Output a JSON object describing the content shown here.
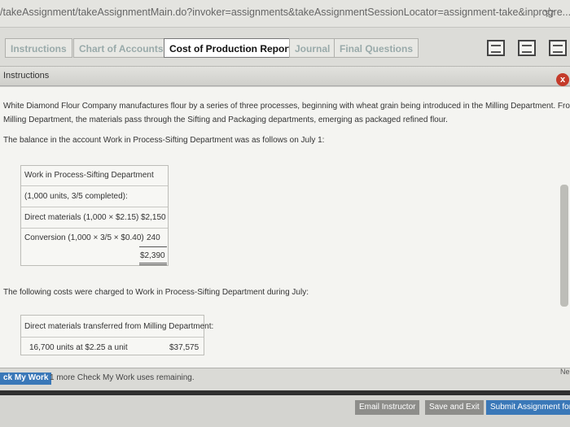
{
  "browser": {
    "url": "/takeAssignment/takeAssignmentMain.do?invoker=assignments&takeAssignmentSessionLocator=assignment-take&inprogre...",
    "star_icon": "star-icon"
  },
  "tabs": [
    {
      "label": "Instructions",
      "state": "dim"
    },
    {
      "label": "Chart of Accounts",
      "state": "dim"
    },
    {
      "label": "Cost of Production Report",
      "state": "active"
    },
    {
      "label": "Journal",
      "state": "dim"
    },
    {
      "label": "Final Questions",
      "state": "dim"
    }
  ],
  "toolbar_icons": [
    "print-icon",
    "calculator-icon",
    "notes-icon"
  ],
  "panel": {
    "title": "Instructions",
    "close_label": "x"
  },
  "content": {
    "intro_line1": "White Diamond Flour Company manufactures flour by a series of three processes, beginning with wheat grain being introduced in the Milling Department. From the",
    "intro_line2": "Milling Department, the materials pass through the Sifting and Packaging departments, emerging as packaged refined flour.",
    "balance_text": "The balance in the account Work in Process-Sifting Department was as follows on July 1:",
    "wip_table": {
      "title": "Work in Process-Sifting Department",
      "units_line": "(1,000 units, 3/5 completed):",
      "row1_label": "Direct materials (1,000 × $2.15)",
      "row1_value": "$2,150",
      "row2_label": "Conversion (1,000 × 3/5 × $0.40)",
      "row2_value": "240",
      "total": "$2,390"
    },
    "costs_text": "The following costs were charged to Work in Process-Sifting Department during July:",
    "costs_table": {
      "header": "Direct materials transferred from Milling Department:",
      "row1_label": "16,700 units at $2.25 a unit",
      "row1_value": "$37,575"
    }
  },
  "bottom": {
    "check_label": "ck My Work",
    "remaining_text": "1 more Check My Work uses remaining.",
    "next_label": "Ne"
  },
  "footer": {
    "email_label": "Email Instructor",
    "save_label": "Save and Exit",
    "submit_label": "Submit Assignment for"
  }
}
